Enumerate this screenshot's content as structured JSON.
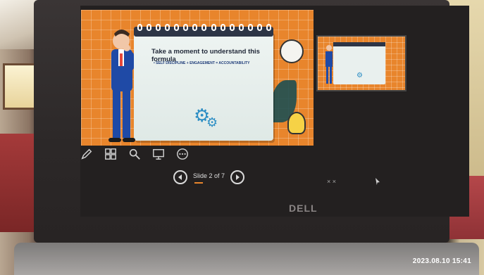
{
  "slideshow": {
    "slide_title": "Take a moment to understand this formula",
    "slide_bullet": "SELF DISCIPLINE + ENGAGEMENT = ACCOUNTABILITY",
    "slide_counter": "Slide 2 of 7"
  },
  "toolbar": {
    "icons": [
      "pen-icon",
      "slides-grid-icon",
      "zoom-icon",
      "screen-icon",
      "more-options-icon"
    ]
  },
  "hardware": {
    "brand": "DELL"
  },
  "photo": {
    "timestamp": "2023.08.10 15:41"
  },
  "colors": {
    "slide_bg": "#e8852c",
    "gear": "#2d8ec4",
    "note_bg": "#eef4f2"
  }
}
